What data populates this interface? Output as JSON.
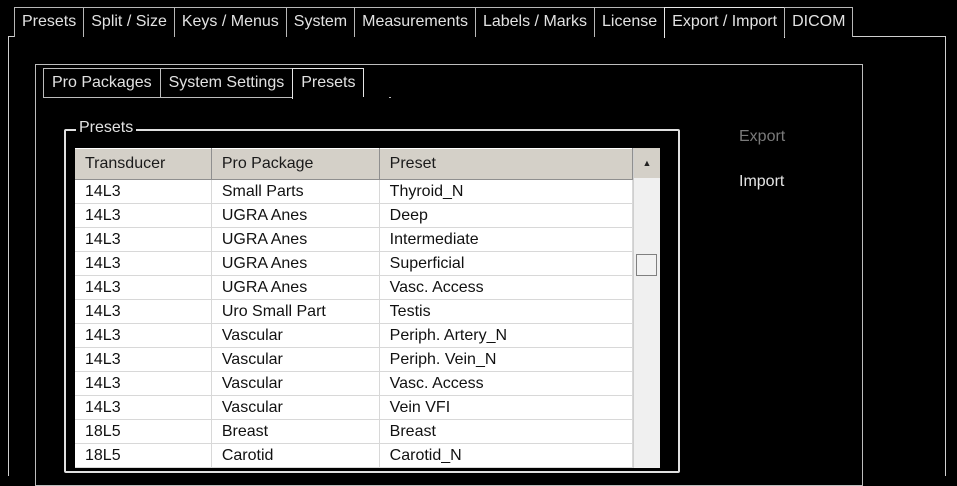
{
  "top_tabs": [
    "Presets",
    "Split / Size",
    "Keys / Menus",
    "System",
    "Measurements",
    "Labels / Marks",
    "License",
    "Export / Import",
    "DICOM"
  ],
  "active_top_tab": "Export / Import",
  "sub_tabs": [
    "Pro Packages",
    "System Settings",
    "Presets"
  ],
  "active_sub_tab": "Presets",
  "group_title": "Presets",
  "table": {
    "headers": [
      "Transducer",
      "Pro Package",
      "Preset"
    ],
    "rows": [
      [
        "14L3",
        "Small Parts",
        "Thyroid_N"
      ],
      [
        "14L3",
        "UGRA Anes",
        "Deep"
      ],
      [
        "14L3",
        "UGRA Anes",
        "Intermediate"
      ],
      [
        "14L3",
        "UGRA Anes",
        "Superficial"
      ],
      [
        "14L3",
        "UGRA Anes",
        "Vasc. Access"
      ],
      [
        "14L3",
        "Uro Small Part",
        "Testis"
      ],
      [
        "14L3",
        "Vascular",
        "Periph. Artery_N"
      ],
      [
        "14L3",
        "Vascular",
        "Periph. Vein_N"
      ],
      [
        "14L3",
        "Vascular",
        "Vasc. Access"
      ],
      [
        "14L3",
        "Vascular",
        "Vein VFI"
      ],
      [
        "18L5",
        "Breast",
        "Breast"
      ],
      [
        "18L5",
        "Carotid",
        "Carotid_N"
      ]
    ]
  },
  "actions": {
    "export_label": "Export",
    "import_label": "Import"
  },
  "scroll_up_glyph": "▲"
}
